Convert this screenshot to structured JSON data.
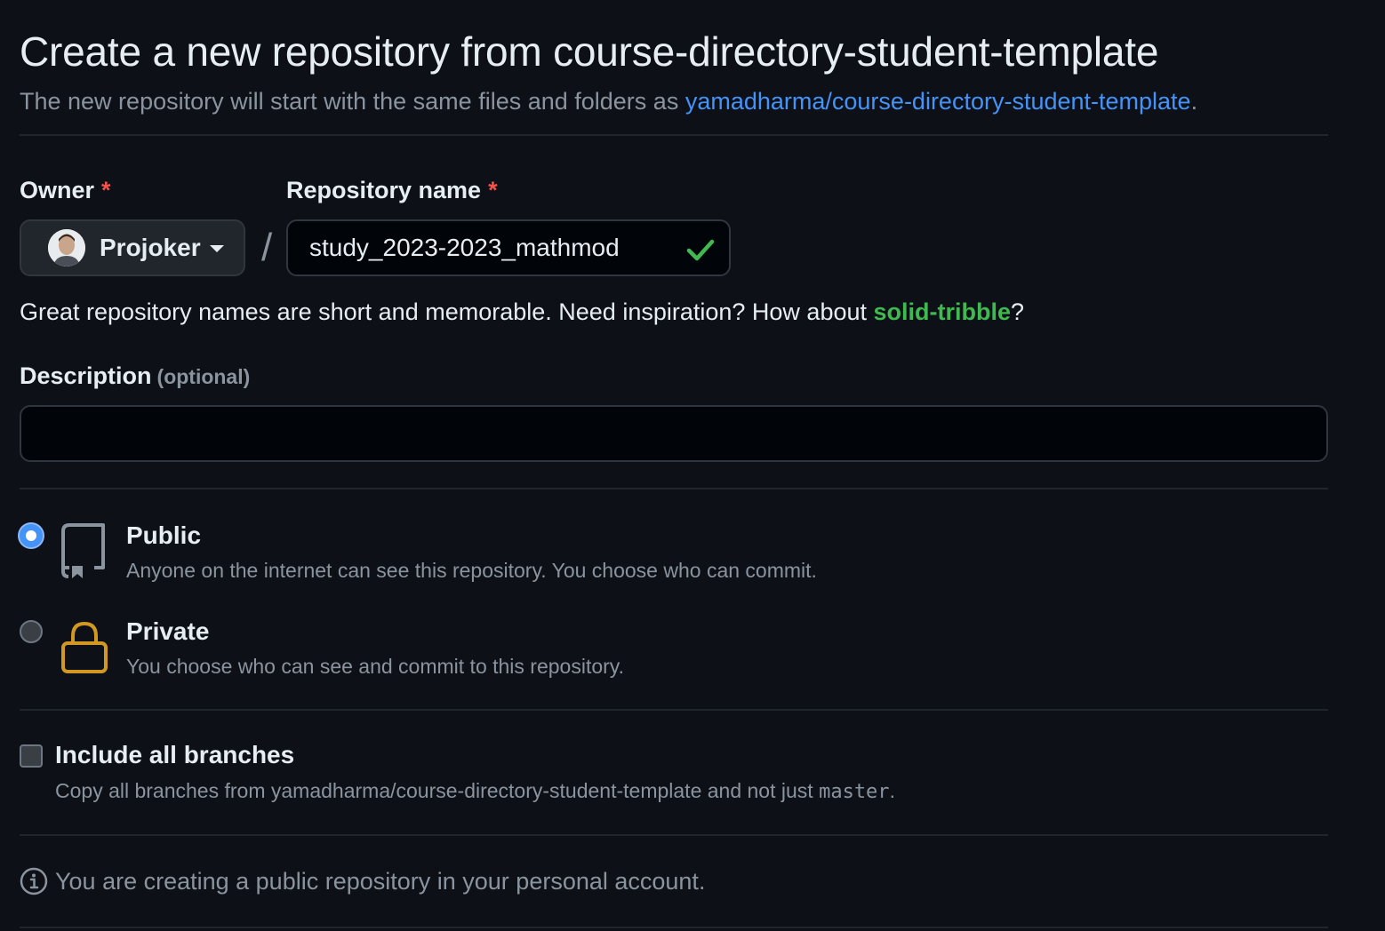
{
  "header": {
    "title": "Create a new repository from course-directory-student-template",
    "subtitle_prefix": "The new repository will start with the same files and folders as ",
    "template_link": "yamadharma/course-directory-student-template",
    "subtitle_suffix": "."
  },
  "owner": {
    "label": "Owner",
    "required_mark": "*",
    "selected": "Projoker",
    "separator": "/"
  },
  "repo_name": {
    "label": "Repository name",
    "required_mark": "*",
    "value": "study_2023-2023_mathmod",
    "status": "valid"
  },
  "name_hint": {
    "prefix": "Great repository names are short and memorable. Need inspiration? How about ",
    "suggestion": "solid-tribble",
    "suffix": "?"
  },
  "description": {
    "label": "Description",
    "optional_text": "(optional)",
    "value": ""
  },
  "visibility": {
    "selected": "public",
    "options": [
      {
        "id": "public",
        "title": "Public",
        "description": "Anyone on the internet can see this repository. You choose who can commit.",
        "icon": "repo-icon"
      },
      {
        "id": "private",
        "title": "Private",
        "description": "You choose who can see and commit to this repository.",
        "icon": "lock-icon"
      }
    ]
  },
  "branches": {
    "checked": false,
    "title": "Include all branches",
    "description_prefix": "Copy all branches from yamadharma/course-directory-student-template and not just ",
    "branch_name": "master",
    "description_suffix": "."
  },
  "notice": {
    "icon": "info-icon",
    "text": "You are creating a public repository in your personal account."
  },
  "colors": {
    "background": "#0d1117",
    "link": "#4493f8",
    "success": "#3fb950",
    "required": "#f85149",
    "lock": "#d29922",
    "muted": "#8b949e"
  }
}
